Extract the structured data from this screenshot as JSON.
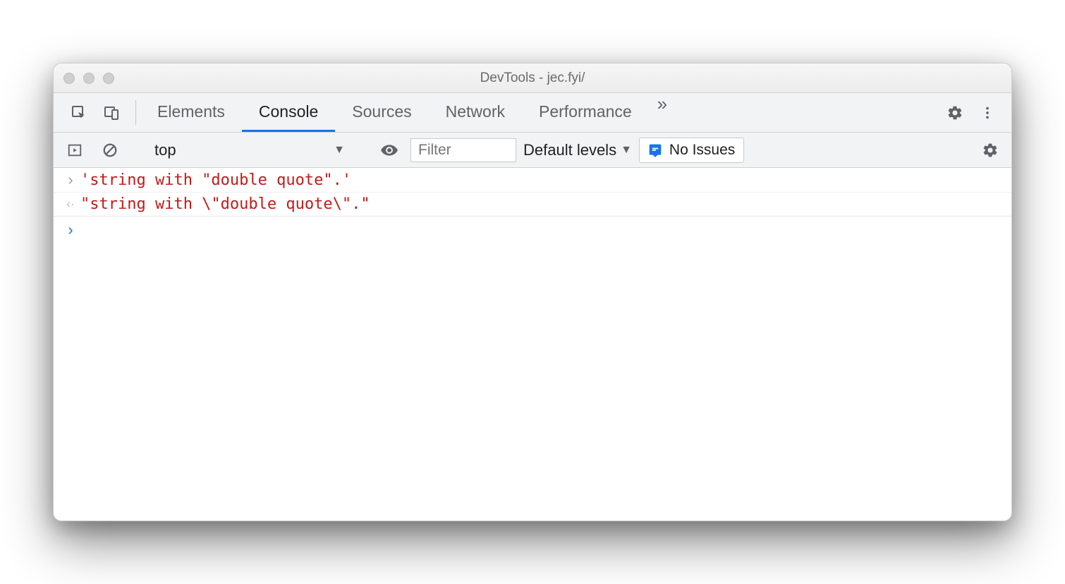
{
  "window": {
    "title": "DevTools - jec.fyi/"
  },
  "tabs": {
    "items": [
      "Elements",
      "Console",
      "Sources",
      "Network",
      "Performance"
    ],
    "active": "Console"
  },
  "toolbar": {
    "context": "top",
    "filter_placeholder": "Filter",
    "levels": "Default levels",
    "issues": "No Issues"
  },
  "console": {
    "input_line": "'string with \"double quote\".'",
    "output_line": "\"string with \\\"double quote\\\".\""
  }
}
